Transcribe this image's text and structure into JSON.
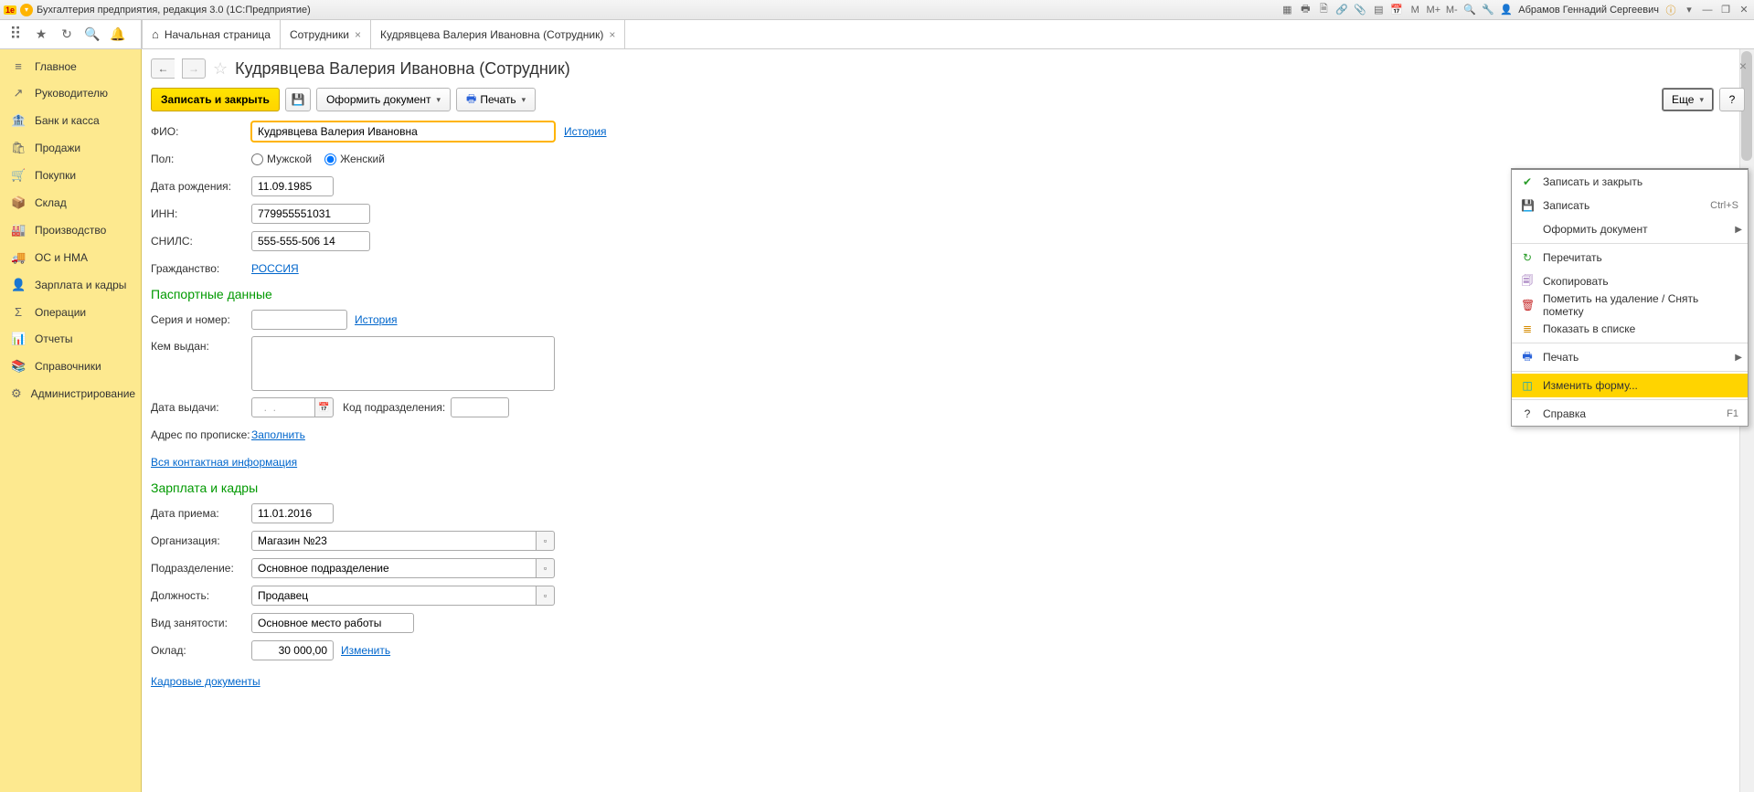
{
  "titlebar": {
    "title": "Бухгалтерия предприятия, редакция 3.0  (1С:Предприятие)",
    "user": "Абрамов Геннадий Сергеевич"
  },
  "tabs": {
    "home": "Начальная страница",
    "employees": "Сотрудники",
    "current": "Кудрявцева Валерия Ивановна (Сотрудник)"
  },
  "sidebar": [
    {
      "icon": "≡",
      "label": "Главное"
    },
    {
      "icon": "↗",
      "label": "Руководителю"
    },
    {
      "icon": "🏦",
      "label": "Банк и касса"
    },
    {
      "icon": "🛍",
      "label": "Продажи"
    },
    {
      "icon": "🛒",
      "label": "Покупки"
    },
    {
      "icon": "📦",
      "label": "Склад"
    },
    {
      "icon": "🏭",
      "label": "Производство"
    },
    {
      "icon": "🚚",
      "label": "ОС и НМА"
    },
    {
      "icon": "👤",
      "label": "Зарплата и кадры"
    },
    {
      "icon": "Σ",
      "label": "Операции"
    },
    {
      "icon": "📊",
      "label": "Отчеты"
    },
    {
      "icon": "📚",
      "label": "Справочники"
    },
    {
      "icon": "⚙",
      "label": "Администрирование"
    }
  ],
  "page": {
    "title": "Кудрявцева Валерия Ивановна (Сотрудник)"
  },
  "actions": {
    "save_close": "Записать и закрыть",
    "format_doc": "Оформить документ",
    "print": "Печать",
    "more": "Еще",
    "help": "?"
  },
  "form": {
    "fio_label": "ФИО:",
    "fio_value": "Кудрявцева Валерия Ивановна",
    "history_link": "История",
    "gender_label": "Пол:",
    "gender_m": "Мужской",
    "gender_f": "Женский",
    "dob_label": "Дата рождения:",
    "dob_value": "11.09.1985",
    "inn_label": "ИНН:",
    "inn_value": "779955551031",
    "snils_label": "СНИЛС:",
    "snils_value": "555-555-506 14",
    "citizenship_label": "Гражданство:",
    "citizenship_value": "РОССИЯ",
    "passport_section": "Паспортные данные",
    "series_label": "Серия и номер:",
    "issued_by_label": "Кем выдан:",
    "issue_date_label": "Дата выдачи:",
    "issue_date_value": "  .  .    ",
    "unit_code_label": "Код подразделения:",
    "addr_label": "Адрес по прописке:",
    "fill_link": "Заполнить",
    "all_contacts_link": "Вся контактная информация",
    "salary_section": "Зарплата и кадры",
    "hire_date_label": "Дата приема:",
    "hire_date_value": "11.01.2016",
    "org_label": "Организация:",
    "org_value": "Магазин №23",
    "dept_label": "Подразделение:",
    "dept_value": "Основное подразделение",
    "position_label": "Должность:",
    "position_value": "Продавец",
    "emp_type_label": "Вид занятости:",
    "emp_type_value": "Основное место работы",
    "salary_label": "Оклад:",
    "salary_value": "30 000,00",
    "change_link": "Изменить",
    "hr_docs_link": "Кадровые документы"
  },
  "menu": {
    "save_close": "Записать и закрыть",
    "save": "Записать",
    "save_shortcut": "Ctrl+S",
    "format_doc": "Оформить документ",
    "reread": "Перечитать",
    "copy": "Скопировать",
    "mark_delete": "Пометить на удаление / Снять пометку",
    "show_in_list": "Показать в списке",
    "print": "Печать",
    "change_form": "Изменить форму...",
    "help": "Справка",
    "help_shortcut": "F1"
  }
}
